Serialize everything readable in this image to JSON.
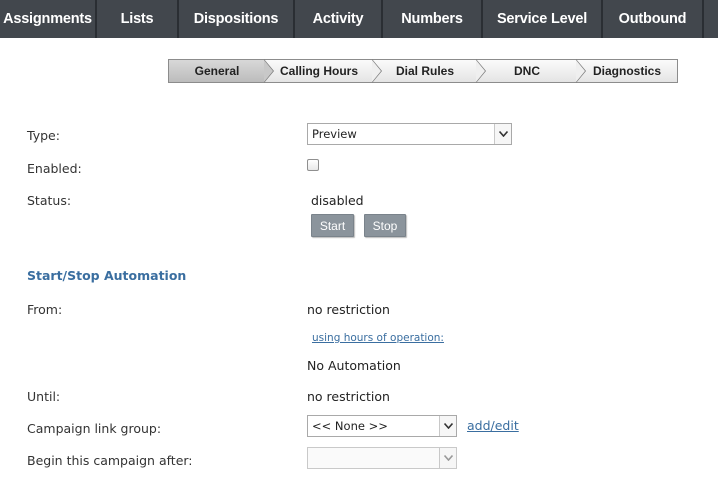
{
  "top_tabs": [
    "Assignments",
    "Lists",
    "Dispositions",
    "Activity",
    "Numbers",
    "Service Level",
    "Outbound"
  ],
  "steps": [
    "General",
    "Calling Hours",
    "Dial Rules",
    "DNC",
    "Diagnostics"
  ],
  "form": {
    "type_label": "Type:",
    "type_value": "Preview",
    "enabled_label": "Enabled:",
    "status_label": "Status:",
    "status_value": "disabled",
    "start_button": "Start",
    "stop_button": "Stop",
    "automation_title": "Start/Stop Automation",
    "from_label": "From:",
    "from_value": "no restriction",
    "hours_link": "using hours of operation:",
    "no_automation": "No Automation",
    "until_label": "Until:",
    "until_value": "no restriction",
    "link_group_label": "Campaign link group:",
    "link_group_value": "<< None >>",
    "add_edit_link": "add/edit",
    "begin_after_label": "Begin this campaign after:",
    "begin_after_value": ""
  },
  "colors": {
    "topbar": "#42474d",
    "section_title": "#3a6ea0",
    "button": "#8b949c"
  }
}
